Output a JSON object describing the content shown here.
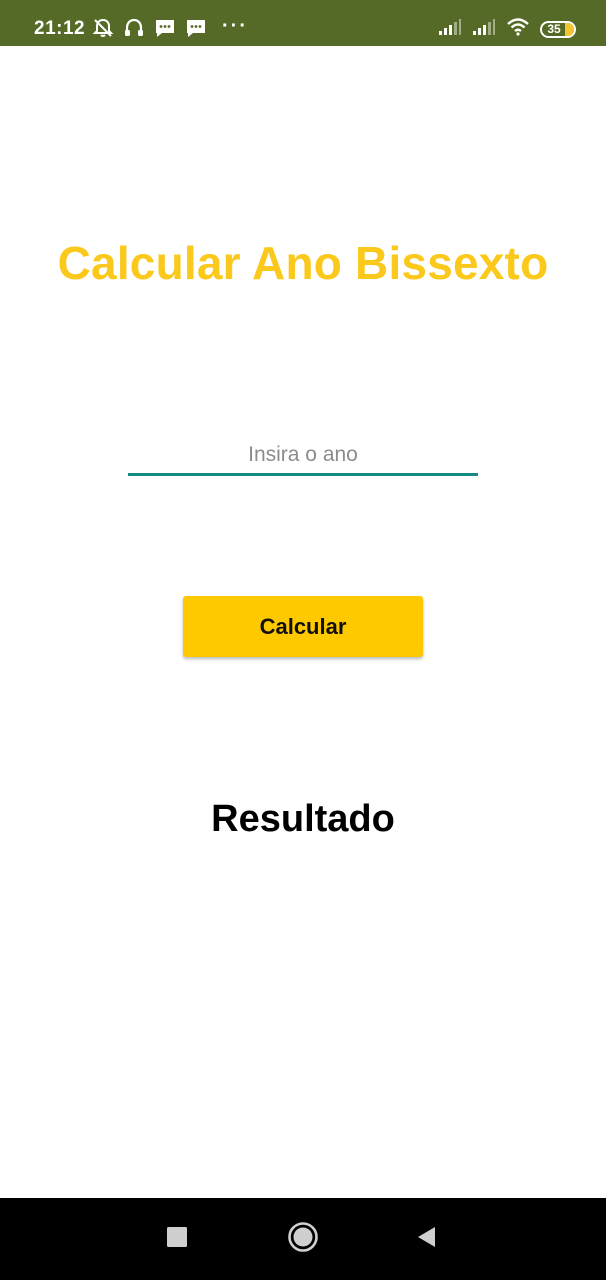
{
  "status_bar": {
    "time": "21:12",
    "more_indicator": "···",
    "battery_level": "35",
    "background_color": "#556a26",
    "icons_left": [
      "alarm-off-icon",
      "headset-icon",
      "message-icon",
      "message-icon"
    ],
    "icons_right": [
      "signal-icon",
      "signal-icon",
      "wifi-icon",
      "battery-icon"
    ]
  },
  "main": {
    "title": "Calcular Ano Bissexto",
    "title_color": "#fbc81c",
    "year_input": {
      "value": "",
      "placeholder": "Insira o ano"
    },
    "calculate_button_label": "Calcular",
    "button_color": "#ffc900",
    "result_label": "Resultado"
  },
  "nav_bar": {
    "buttons": [
      "recents-icon",
      "home-icon",
      "back-icon"
    ]
  }
}
